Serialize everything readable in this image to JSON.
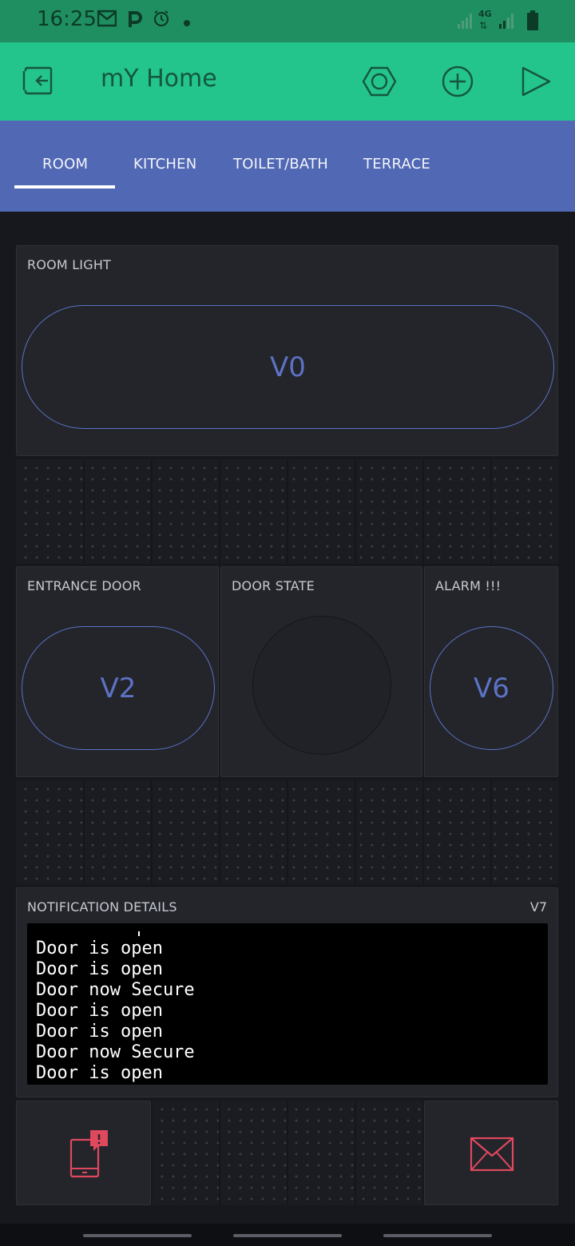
{
  "status_bar": {
    "time": "16:25",
    "icons": [
      "gmail-icon",
      "p-icon",
      "alarm-icon",
      "dot-icon"
    ],
    "right_icons": [
      "signal-icon",
      "4g-icon",
      "signal-icon",
      "battery-icon"
    ],
    "network_label": "4G"
  },
  "app_bar": {
    "title": "mY Home",
    "buttons": [
      "exit-icon",
      "settings-icon",
      "add-icon",
      "play-icon"
    ],
    "accent": "#24c48d"
  },
  "tabs": {
    "items": [
      {
        "label": "ROOM",
        "active": true
      },
      {
        "label": "KITCHEN",
        "active": false
      },
      {
        "label": "TOILET/BATH",
        "active": false
      },
      {
        "label": "TERRACE",
        "active": false
      }
    ],
    "color": "#5168b4"
  },
  "widgets": {
    "room_light": {
      "label": "ROOM LIGHT",
      "pin": "V0"
    },
    "entrance_door": {
      "label": "ENTRANCE DOOR",
      "pin": "V2"
    },
    "door_state": {
      "label": "DOOR STATE"
    },
    "alarm": {
      "label": "ALARM !!!",
      "pin": "V6"
    },
    "notification": {
      "label": "NOTIFICATION DETAILS",
      "pin": "V7",
      "lines": [
        "Door is open",
        "Door is open",
        "Door now Secure",
        "Door is open",
        "Door is open",
        "Door now Secure",
        "Door is open"
      ]
    },
    "notify_widget": {
      "icon": "phone-alert-icon"
    },
    "email_widget": {
      "icon": "envelope-icon"
    },
    "accent_widget_color": "#5c72c4",
    "alert_color": "#e0485e"
  }
}
